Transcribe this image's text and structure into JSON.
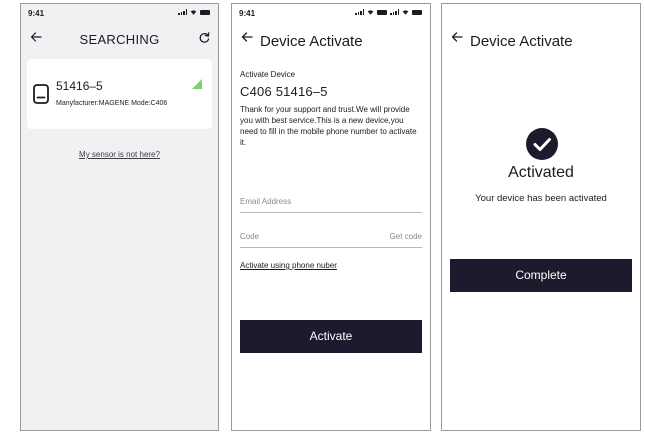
{
  "colors": {
    "primary_button": "#1c1a2c",
    "search_bg": "#f1f1f3",
    "rssi_green": "#7ccf6e"
  },
  "screen1": {
    "status_time": "9:41",
    "title": "SEARCHING",
    "device": {
      "name": "51416–5",
      "info": "Manyfacturer:MAGENE  Mode:C406"
    },
    "not_here_link": "My sensor is not here?"
  },
  "screen2": {
    "status_time": "9:41",
    "title": "Device Activate",
    "subtitle": "Activate Device",
    "device_title": "C406 51416–5",
    "message": "Thank for your support and trust.We will provide you with best service.This is a new device,you need to fill in the mobile phone number to activate it.",
    "email_placeholder": "Email Address",
    "code_placeholder": "Code",
    "get_code": "Get code",
    "phone_link": "Activate using phone nuber",
    "activate_button": "Activate"
  },
  "screen3": {
    "title": "Device Activate",
    "heading": "Activated",
    "message": "Your device has been activated",
    "complete_button": "Complete"
  }
}
